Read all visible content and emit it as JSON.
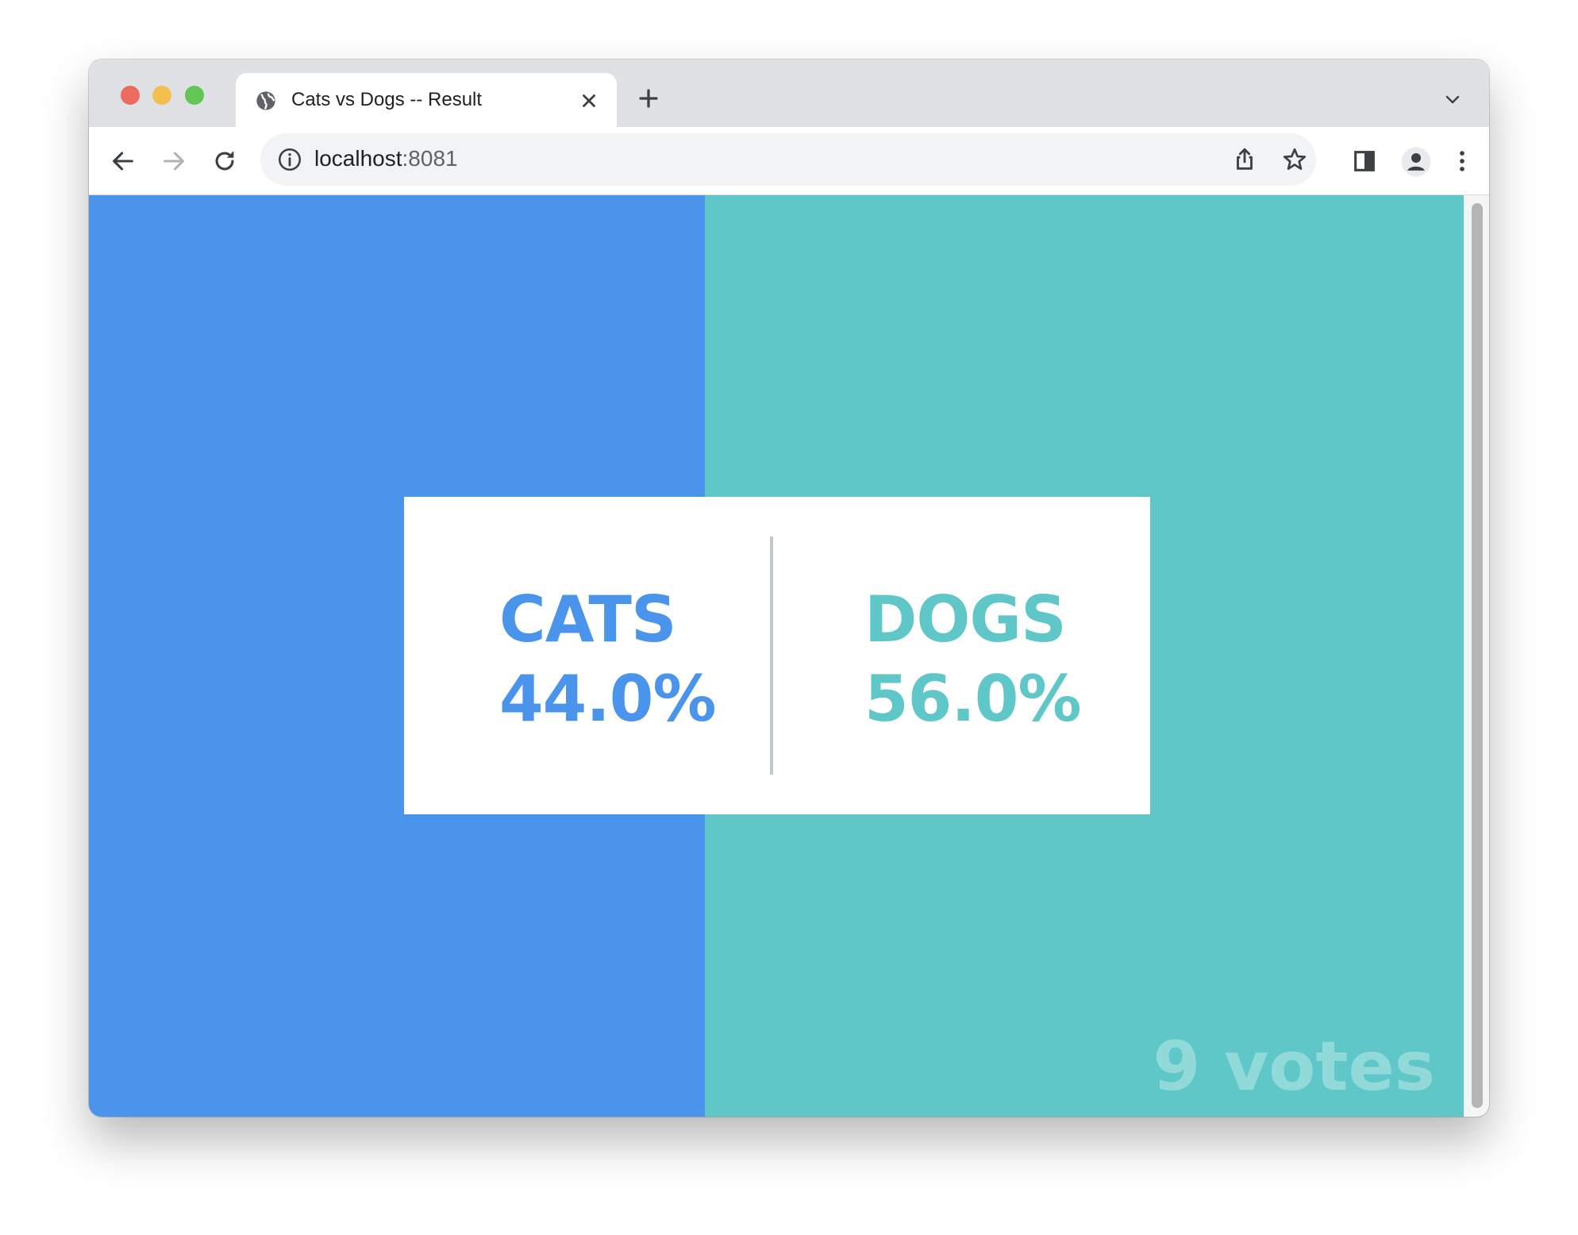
{
  "browser": {
    "tab": {
      "title": "Cats vs Dogs -- Result"
    },
    "address_bar": {
      "host": "localhost",
      "port": ":8081"
    }
  },
  "results": {
    "option_a": {
      "label": "CATS",
      "percent": "44.0%",
      "color": "#4a94eb",
      "share": 0.44
    },
    "option_b": {
      "label": "DOGS",
      "percent": "56.0%",
      "color": "#5fc7c8",
      "share": 0.56
    },
    "total_votes": "9 votes"
  },
  "icons": {
    "tab_favicon": "globe-icon",
    "tab_close": "close-icon",
    "new_tab": "plus-icon",
    "tab_list": "chevron-down-icon",
    "back": "arrow-left-icon",
    "forward": "arrow-right-icon",
    "reload": "reload-icon",
    "site_info": "info-icon",
    "share": "share-icon",
    "bookmark": "star-icon",
    "side_panel": "side-panel-icon",
    "profile": "profile-icon",
    "menu": "more-vertical-icon"
  }
}
